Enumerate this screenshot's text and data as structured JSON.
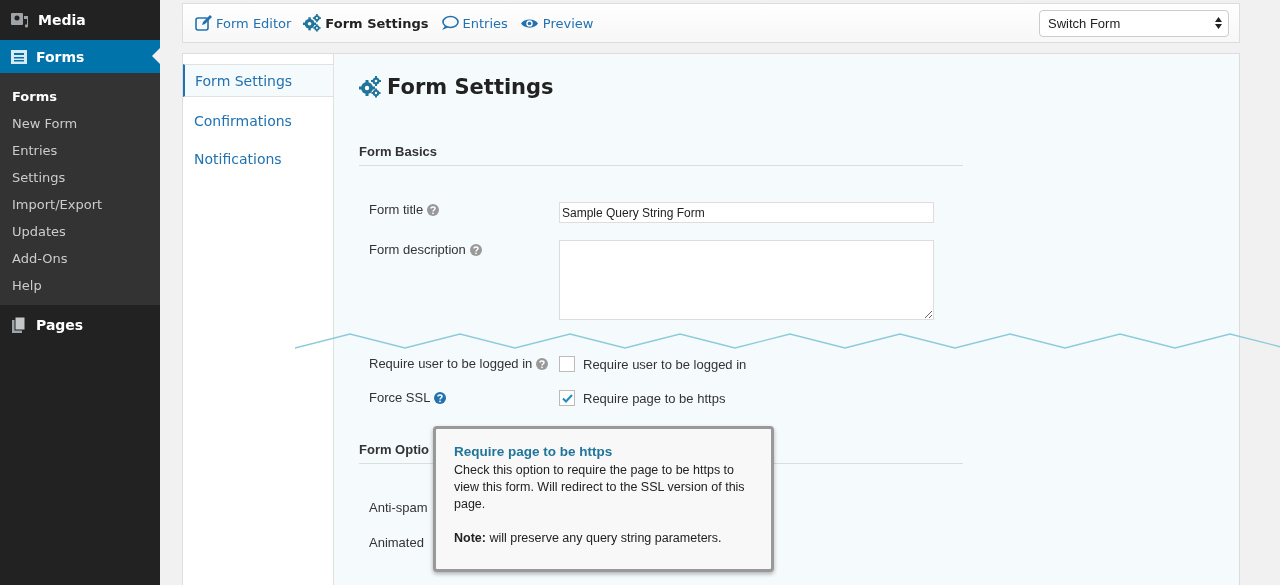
{
  "sidebar": {
    "menu": [
      {
        "label": "Media",
        "selected": false
      },
      {
        "label": "Forms",
        "selected": true,
        "submenu": [
          {
            "label": "Forms",
            "selected": true
          },
          {
            "label": "New Form",
            "selected": false
          },
          {
            "label": "Entries",
            "selected": false
          },
          {
            "label": "Settings",
            "selected": false
          },
          {
            "label": "Import/Export",
            "selected": false
          },
          {
            "label": "Updates",
            "selected": false
          },
          {
            "label": "Add-Ons",
            "selected": false
          },
          {
            "label": "Help",
            "selected": false
          }
        ]
      },
      {
        "label": "Pages",
        "selected": false
      }
    ]
  },
  "toolbar": {
    "tabs": [
      {
        "label": "Form Editor",
        "selected": false
      },
      {
        "label": "Form Settings",
        "selected": true
      },
      {
        "label": "Entries",
        "selected": false
      },
      {
        "label": "Preview",
        "selected": false
      }
    ],
    "switch_form": "Switch Form"
  },
  "subnav": [
    {
      "label": "Form Settings",
      "selected": true
    },
    {
      "label": "Confirmations",
      "selected": false
    },
    {
      "label": "Notifications",
      "selected": false
    }
  ],
  "title": "Form Settings",
  "form_basics": {
    "heading": "Form Basics",
    "title_label": "Form title",
    "title_value": "Sample Query String Form",
    "description_label": "Form description"
  },
  "restrictions": [
    {
      "label": "Require user to be logged in",
      "help_active": false,
      "checkbox_label": "Require user to be logged in",
      "checked": false
    },
    {
      "label": "Force SSL",
      "help_active": true,
      "checkbox_label": "Require page to be https",
      "checked": true
    }
  ],
  "form_options": {
    "heading": "Form Optio",
    "rows": [
      "Anti-spam",
      "Animated"
    ]
  },
  "tooltip": {
    "title": "Require page to be https",
    "body": "Check this option to require the page to be https to view this form. Will redirect to the SSL version of this page.",
    "note": "**Note:** will preserve any query string parameters."
  }
}
